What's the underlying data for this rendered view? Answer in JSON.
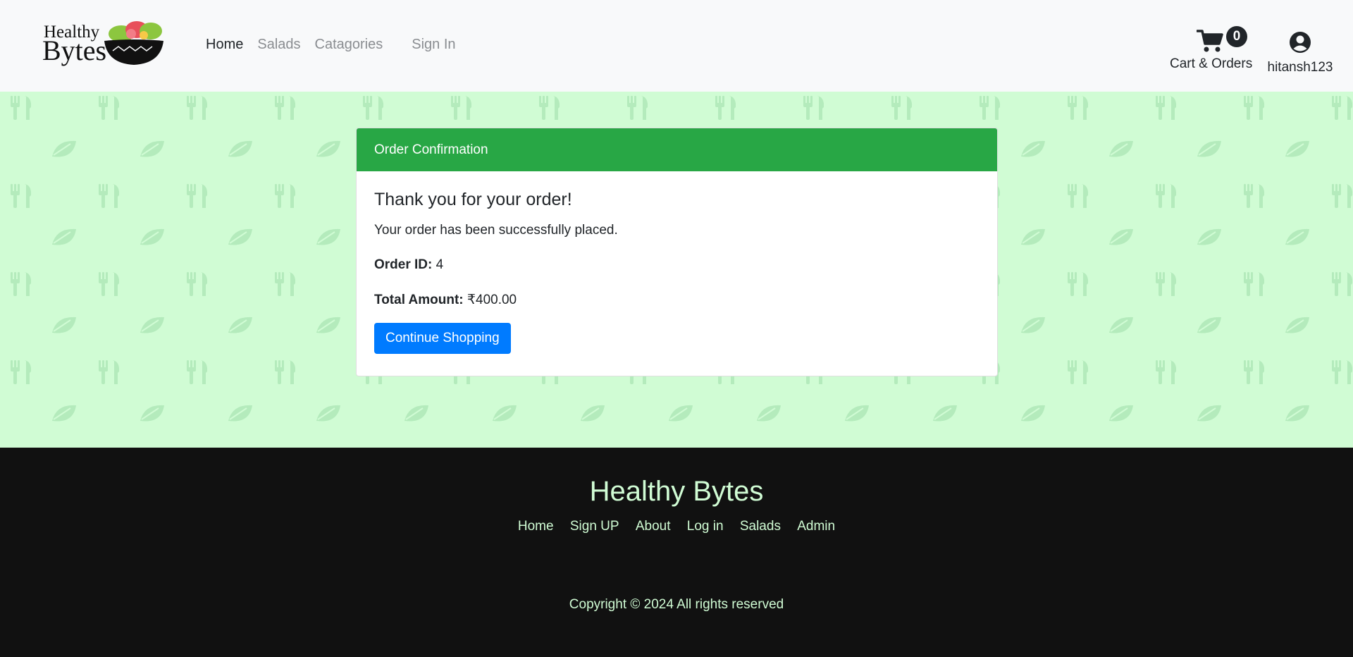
{
  "header": {
    "brand_top": "Healthy",
    "brand_bottom": "Bytes",
    "nav": {
      "home": "Home",
      "salads": "Salads",
      "categories": "Catagories",
      "sign_in": "Sign In"
    },
    "cart": {
      "count": "0",
      "label": "Cart & Orders",
      "icon": "cart-icon"
    },
    "user": {
      "label": "hitansh123",
      "icon": "user-circle-icon"
    }
  },
  "card": {
    "header": "Order Confirmation",
    "title": "Thank you for your order!",
    "message": "Your order has been successfully placed.",
    "order_id_label": "Order ID:",
    "order_id_value": " 4",
    "total_label": "Total Amount:",
    "total_value": " ₹400.00",
    "button": "Continue Shopping"
  },
  "footer": {
    "title": "Healthy Bytes",
    "links": [
      "Home",
      "Sign UP",
      "About",
      "Log in",
      "Salads",
      "Admin"
    ],
    "copyright": "Copyright © 2024 All rights reserved"
  },
  "colors": {
    "navbar_bg": "#f8f9fa",
    "page_bg": "#d0fcd4",
    "pattern_icon": "#b4ebbc",
    "card_header": "#28a745",
    "primary_button": "#007bff",
    "footer_bg": "#111111",
    "footer_text": "#d0fcd4"
  }
}
